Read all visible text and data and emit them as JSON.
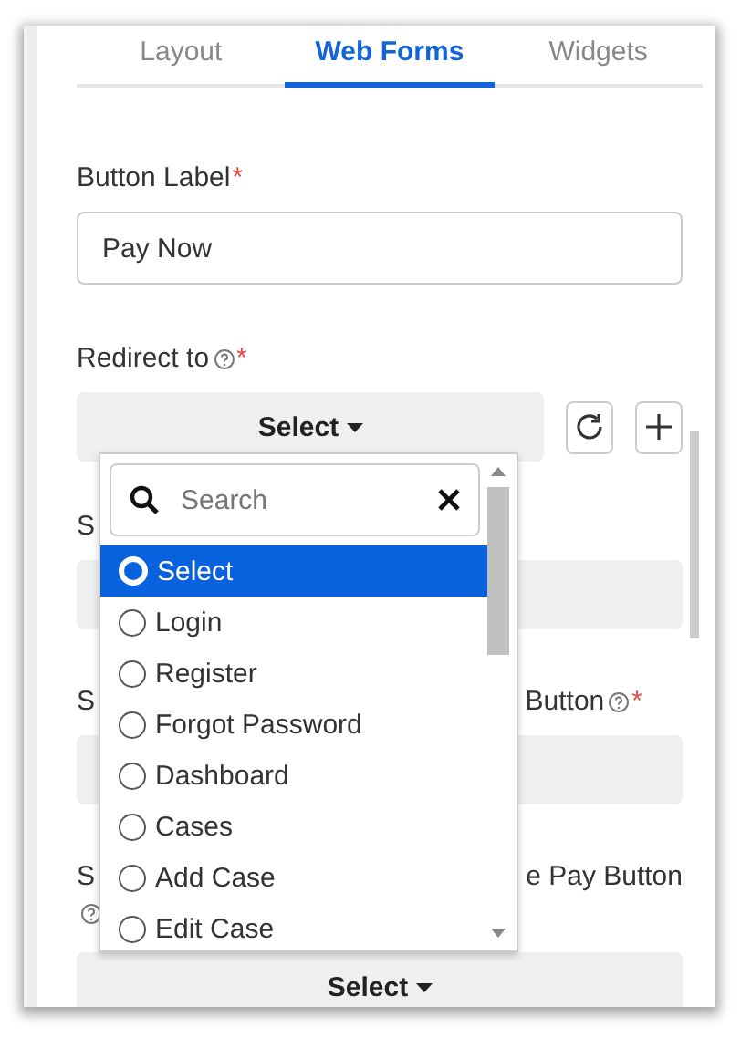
{
  "tabs": [
    {
      "label": "Layout",
      "selected": false
    },
    {
      "label": "Web Forms",
      "selected": true
    },
    {
      "label": "Widgets",
      "selected": false
    }
  ],
  "button_label": {
    "label": "Button Label",
    "required_mark": "*",
    "value": "Pay Now"
  },
  "redirect_to": {
    "label": "Redirect to",
    "required_mark": "*",
    "help": true,
    "value": "Select"
  },
  "fields": [
    {
      "kind": "blank",
      "label_left": "S"
    },
    {
      "kind": "blank",
      "label_left": "S",
      "label_right": "Button",
      "help_inline": true,
      "required_mark": "*"
    },
    {
      "kind": "select",
      "label_left": "S",
      "label_right": "e Pay Button",
      "help_below": true,
      "value": "Select"
    }
  ],
  "dropdown": {
    "search_placeholder": "Search",
    "options": [
      {
        "label": "Select",
        "selected": true
      },
      {
        "label": "Login",
        "selected": false
      },
      {
        "label": "Register",
        "selected": false
      },
      {
        "label": "Forgot Password",
        "selected": false
      },
      {
        "label": "Dashboard",
        "selected": false
      },
      {
        "label": "Cases",
        "selected": false
      },
      {
        "label": "Add Case",
        "selected": false
      },
      {
        "label": "Edit Case",
        "selected": false
      }
    ]
  }
}
